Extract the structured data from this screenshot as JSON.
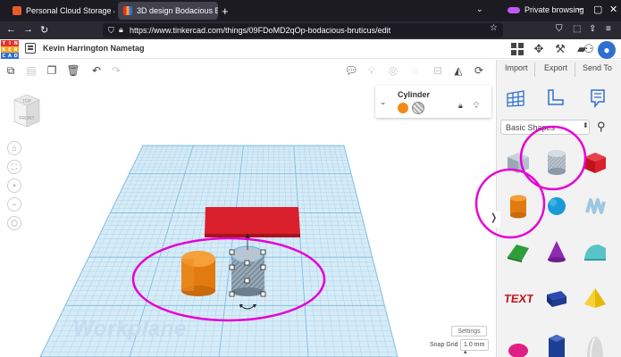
{
  "browser": {
    "tabs": [
      {
        "label": "Personal Cloud Storage & "
      },
      {
        "label": "3D design Bodacious Bru"
      }
    ],
    "private_label": "Private browsing",
    "url": "https://www.tinkercad.com/things/09FDoMD2qOp-bodacious-bruticus/edit"
  },
  "header": {
    "logo_letters": [
      "T",
      "I",
      "N",
      "K",
      "E",
      "R",
      "C",
      "A",
      "D"
    ],
    "design_title": "Kevin Harrington Nametag"
  },
  "right_panel": {
    "import_label": "Import",
    "export_label": "Export",
    "sendto_label": "Send To",
    "shape_category": "Basic Shapes"
  },
  "inspector": {
    "title": "Cylinder",
    "colors": {
      "solid": "#f28a19",
      "hole": "#aaaaaa"
    }
  },
  "viewcube": {
    "top": "TOP",
    "front": "FRONT"
  },
  "workplane": {
    "label": "Workplane",
    "settings_label": "Settings",
    "snap_grid_label": "Snap Grid",
    "snap_grid_value": "1.0 mm ▴"
  },
  "colors": {
    "accent": "#2f6fd1",
    "annotation": "#e600d4",
    "orange_cylinder": "#f28a19",
    "red_box": "#d9202c",
    "grid": "#a9d3ec"
  }
}
